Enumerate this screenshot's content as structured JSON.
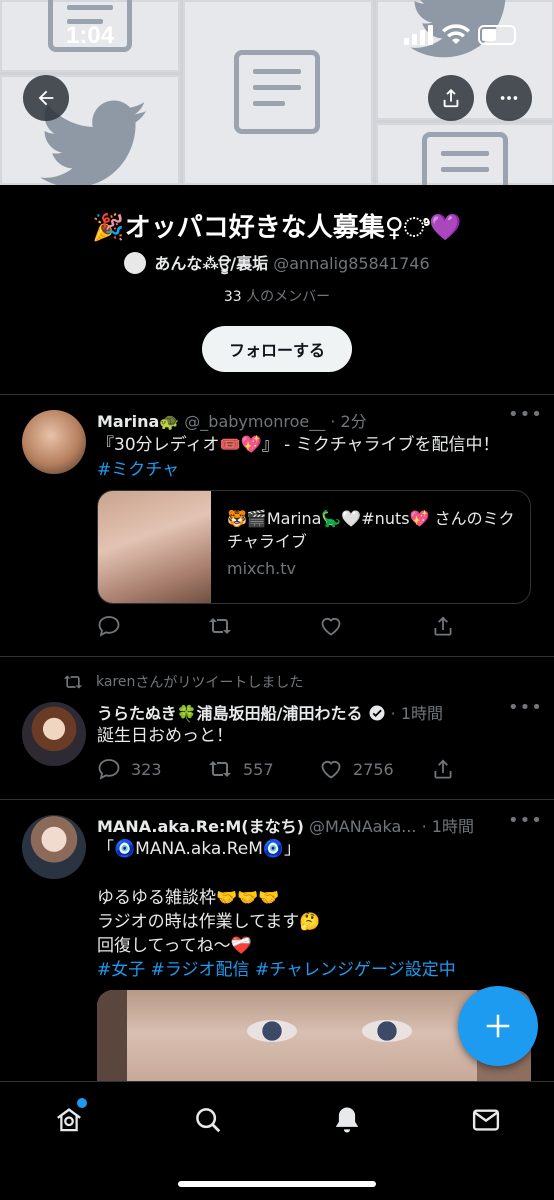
{
  "status_bar": {
    "time": "1:04"
  },
  "header": {
    "back_icon": "arrow-left-icon",
    "share_icon": "share-icon",
    "more_icon": "more-horizontal-icon"
  },
  "community": {
    "title": "🎉オッパコ好きな人募集♀︎ಿ💜",
    "owner_name": "あんな⁂ਊ/裏垢",
    "owner_handle": "@annalig85841746",
    "member_count": "33",
    "member_suffix": "人のメンバー",
    "follow_label": "フォローする"
  },
  "tweets": [
    {
      "name": "Marina🐢",
      "handle": "@_babymonroe__",
      "time": "· 2分",
      "text_line1": "『30分レディオ🎟️💖』 - ミクチャライブを配信中！",
      "hashtag": "#ミクチャ",
      "card": {
        "title": "🐯🎬Marina🦕🤍#nuts💖 さんのミクチャライブ",
        "domain": "mixch.tv"
      },
      "reply_count": "",
      "retweet_count": "",
      "like_count": ""
    },
    {
      "retweet_by": "karen",
      "retweet_suffix": "さんがリツイートしました",
      "name": "うらたぬき🍀浦島坂田船/浦田わたる",
      "time": "· 1時間",
      "text_line1": "誕生日おめっと！",
      "reply_count": "323",
      "retweet_count": "557",
      "like_count": "2756"
    },
    {
      "name": "MANA.aka.Re:M(まなち)",
      "handle": "@MANAaka...",
      "time": "· 1時間",
      "text_line1": "「🧿MANA.aka.ReM🧿」",
      "text_line2": "ゆるゆる雑談枠🤝🤝🤝",
      "text_line3": "ラジオの時は作業してます🤔",
      "text_line4": "回復してってね〜❤️‍🩹",
      "hashtags": "#女子 #ラジオ配信 #チャレンジゲージ設定中"
    }
  ],
  "tabs": [
    "home-icon",
    "search-icon",
    "notifications-bell-icon",
    "messages-mail-icon"
  ],
  "accent_color": "#1d9bf0"
}
